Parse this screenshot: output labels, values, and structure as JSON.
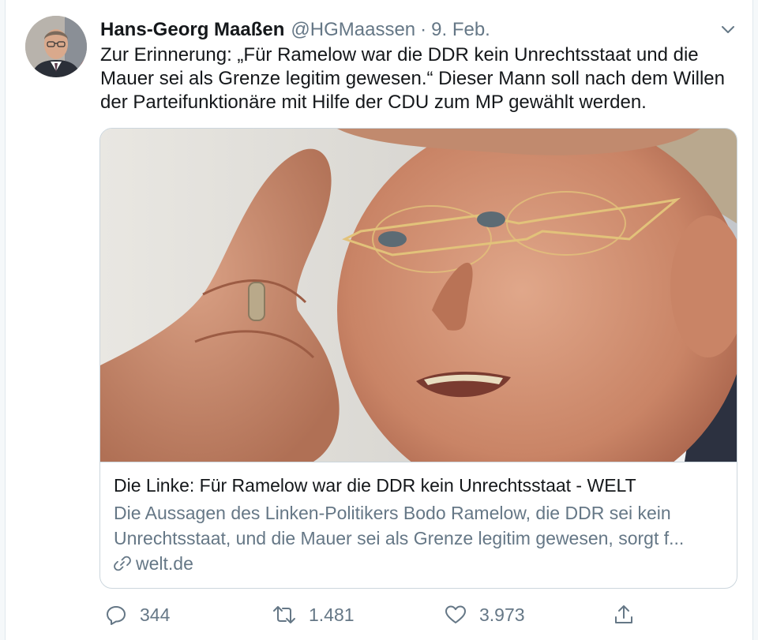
{
  "author": {
    "display_name": "Hans-Georg Maaßen",
    "handle": "@HGMaassen",
    "separator": "·",
    "time": "9. Feb."
  },
  "tweet": {
    "lines": [
      "Zur Erinnerung: „Für Ramelow war die DDR kein Unrechtsstaat und die",
      "Mauer sei als Grenze legitim gewesen.“ Dieser Mann soll nach dem Willen",
      "der Parteifunktionäre mit Hilfe der CDU zum MP gewählt werden."
    ]
  },
  "card": {
    "title": "Die Linke: Für Ramelow war die DDR kein Unrechtsstaat - WELT",
    "description_lines": [
      "Die Aussagen des Linken-Politikers Bodo Ramelow, die DDR sei kein",
      "Unrechtsstaat, und die Mauer sei als Grenze legitim gewesen, sorgt f..."
    ],
    "domain": "welt.de"
  },
  "actions": {
    "replies": "344",
    "retweets": "1.481",
    "likes": "3.973"
  },
  "icons": {
    "more": "chevron-down-icon",
    "reply": "reply-icon",
    "retweet": "retweet-icon",
    "like": "heart-icon",
    "share": "share-icon",
    "link": "link-icon"
  },
  "colors": {
    "text": "#14171a",
    "secondary": "#657786",
    "border": "#ccd6dd",
    "background": "#f5f8fa"
  }
}
